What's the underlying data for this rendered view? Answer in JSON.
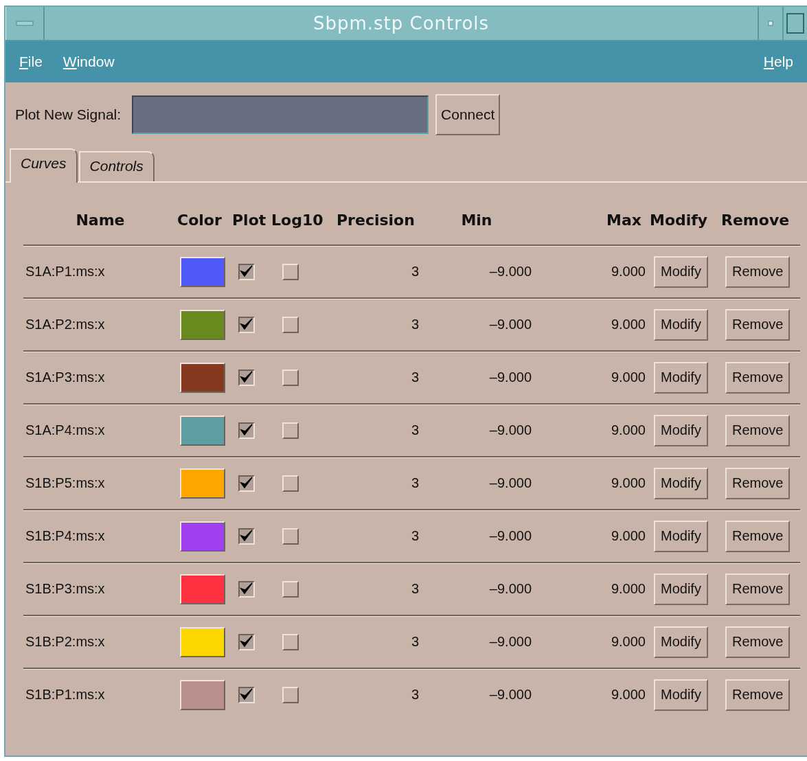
{
  "window": {
    "title": "Sbpm.stp Controls"
  },
  "menu": {
    "left": [
      "File",
      "Window"
    ],
    "right": [
      "Help"
    ]
  },
  "signal": {
    "label": "Plot New Signal:",
    "button": "Connect"
  },
  "tabs": [
    {
      "label": "Curves",
      "selected": true
    },
    {
      "label": "Controls",
      "selected": false
    }
  ],
  "columns": [
    "Name",
    "Color",
    "Plot",
    "Log10",
    "Precision",
    "Min",
    "Max",
    "Modify",
    "Remove"
  ],
  "curves": [
    {
      "name": "S1A:P1:ms:x",
      "color": "#5058f8",
      "plot": true,
      "log10": false,
      "precision": "3",
      "min": "–9.000",
      "max": "9.000",
      "modify": "Modify",
      "remove": "Remove"
    },
    {
      "name": "S1A:P2:ms:x",
      "color": "#688a1e",
      "plot": true,
      "log10": false,
      "precision": "3",
      "min": "–9.000",
      "max": "9.000",
      "modify": "Modify",
      "remove": "Remove"
    },
    {
      "name": "S1A:P3:ms:x",
      "color": "#853a20",
      "plot": true,
      "log10": false,
      "precision": "3",
      "min": "–9.000",
      "max": "9.000",
      "modify": "Modify",
      "remove": "Remove"
    },
    {
      "name": "S1A:P4:ms:x",
      "color": "#5f9ea0",
      "plot": true,
      "log10": false,
      "precision": "3",
      "min": "–9.000",
      "max": "9.000",
      "modify": "Modify",
      "remove": "Remove"
    },
    {
      "name": "S1B:P5:ms:x",
      "color": "#ffa500",
      "plot": true,
      "log10": false,
      "precision": "3",
      "min": "–9.000",
      "max": "9.000",
      "modify": "Modify",
      "remove": "Remove"
    },
    {
      "name": "S1B:P4:ms:x",
      "color": "#a040f0",
      "plot": true,
      "log10": false,
      "precision": "3",
      "min": "–9.000",
      "max": "9.000",
      "modify": "Modify",
      "remove": "Remove"
    },
    {
      "name": "S1B:P3:ms:x",
      "color": "#ff3040",
      "plot": true,
      "log10": false,
      "precision": "3",
      "min": "–9.000",
      "max": "9.000",
      "modify": "Modify",
      "remove": "Remove"
    },
    {
      "name": "S1B:P2:ms:x",
      "color": "#ffd700",
      "plot": true,
      "log10": false,
      "precision": "3",
      "min": "–9.000",
      "max": "9.000",
      "modify": "Modify",
      "remove": "Remove"
    },
    {
      "name": "S1B:P1:ms:x",
      "color": "#bc8f8f",
      "plot": true,
      "log10": false,
      "precision": "3",
      "min": "–9.000",
      "max": "9.000",
      "modify": "Modify",
      "remove": "Remove"
    }
  ]
}
